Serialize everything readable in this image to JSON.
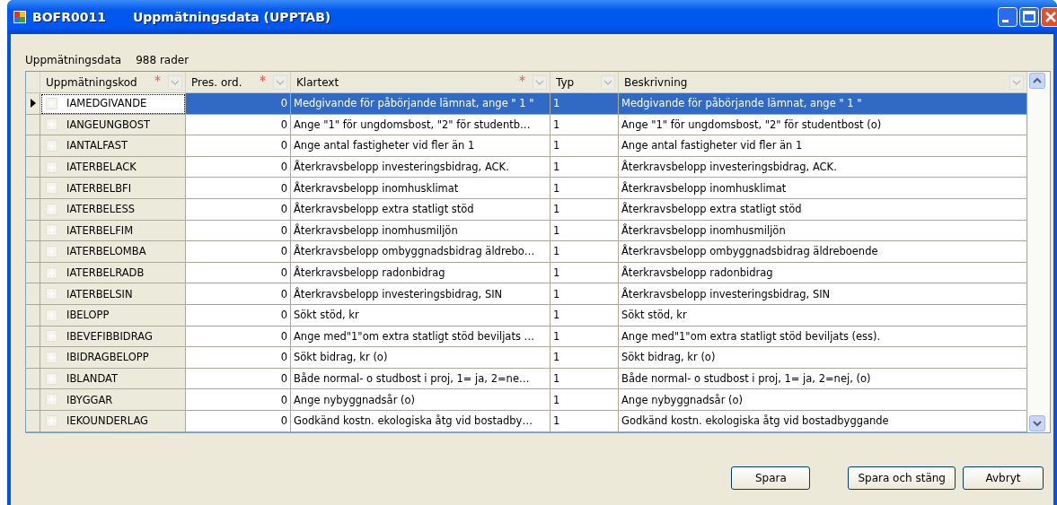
{
  "window": {
    "title_code": "BOFR0011",
    "title": "Uppmätningsdata (UPPTAB)"
  },
  "grid_label": "Uppmätningsdata",
  "row_count": "988 rader",
  "columns": [
    {
      "label": "Uppmätningskod",
      "required": true
    },
    {
      "label": "Pres. ord.",
      "required": true
    },
    {
      "label": "Klartext",
      "required": true
    },
    {
      "label": "Typ",
      "required": false
    },
    {
      "label": "Beskrivning",
      "required": false
    }
  ],
  "rows": [
    {
      "selected": true,
      "cells": [
        "IAMEDGIVANDE",
        "0",
        "Medgivande för påbörjande lämnat, ange \" 1 \"",
        "1",
        "Medgivande för påbörjande lämnat, ange \" 1 \""
      ]
    },
    {
      "selected": false,
      "cells": [
        "IANGEUNGBOST",
        "0",
        "Ange \"1\" för ungdomsbost, \"2\" för studentb…",
        "1",
        "Ange \"1\" för ungdomsbost, \"2\" för studentbost (o)"
      ]
    },
    {
      "selected": false,
      "cells": [
        "IANTALFAST",
        "0",
        "Ange antal fastigheter vid fler än 1",
        "1",
        "Ange antal fastigheter vid fler än 1"
      ]
    },
    {
      "selected": false,
      "cells": [
        "IATERBELACK",
        "0",
        "Återkravsbelopp investeringsbidrag, ACK.",
        "1",
        "Återkravsbelopp investeringsbidrag, ACK."
      ]
    },
    {
      "selected": false,
      "cells": [
        "IATERBELBFI",
        "0",
        "Återkravsbelopp inomhusklimat",
        "1",
        "Återkravsbelopp inomhusklimat"
      ]
    },
    {
      "selected": false,
      "cells": [
        "IATERBELESS",
        "0",
        "Återkravsbelopp extra statligt stöd",
        "1",
        "Återkravsbelopp extra statligt stöd"
      ]
    },
    {
      "selected": false,
      "cells": [
        "IATERBELFIM",
        "0",
        "Återkravsbelopp inomhusmiljön",
        "1",
        "Återkravsbelopp inomhusmiljön"
      ]
    },
    {
      "selected": false,
      "cells": [
        "IATERBELOMBA",
        "0",
        "Återkravsbelopp ombyggnadsbidrag äldrebo…",
        "1",
        "Återkravsbelopp ombyggnadsbidrag äldreboende"
      ]
    },
    {
      "selected": false,
      "cells": [
        "IATERBELRADB",
        "0",
        "Återkravsbelopp radonbidrag",
        "1",
        "Återkravsbelopp radonbidrag"
      ]
    },
    {
      "selected": false,
      "cells": [
        "IATERBELSIN",
        "0",
        "Återkravsbelopp investeringsbidrag, SIN",
        "1",
        "Återkravsbelopp investeringsbidrag, SIN"
      ]
    },
    {
      "selected": false,
      "cells": [
        "IBELOPP",
        "0",
        "Sökt stöd, kr",
        "1",
        "Sökt stöd, kr"
      ]
    },
    {
      "selected": false,
      "cells": [
        "IBEVEFIBBIDRAG",
        "0",
        "Ange med\"1\"om extra statligt stöd beviljats …",
        "1",
        "Ange med\"1\"om extra statligt stöd beviljats (ess)."
      ]
    },
    {
      "selected": false,
      "cells": [
        "IBIDRAGBELOPP",
        "0",
        "Sökt bidrag, kr (o)",
        "1",
        "Sökt bidrag, kr (o)"
      ]
    },
    {
      "selected": false,
      "cells": [
        "IBLANDAT",
        "0",
        "Både normal- o studbost i proj, 1= ja, 2=ne…",
        "1",
        "Både normal- o studbost i proj, 1= ja, 2=nej, (o)"
      ]
    },
    {
      "selected": false,
      "cells": [
        "IBYGGAR",
        "0",
        "Ange nybyggnadsår (o)",
        "1",
        "Ange nybyggnadsår (o)"
      ]
    },
    {
      "selected": false,
      "cells": [
        "IEKOUNDERLAG",
        "0",
        "Godkänd kostn. ekologiska åtg vid bostadby…",
        "1",
        "Godkänd kostn. ekologiska åtg vid bostadbyggande"
      ]
    }
  ],
  "buttons": [
    "Spara",
    "Spara och stäng",
    "Avbryt"
  ]
}
